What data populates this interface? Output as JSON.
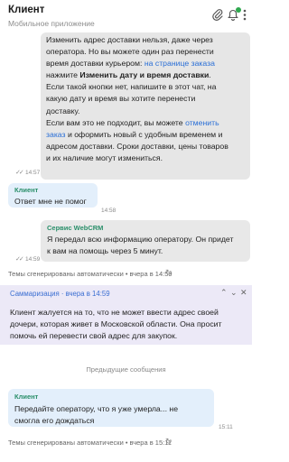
{
  "header": {
    "title": "Клиент",
    "subtitle": "Мобильное приложение"
  },
  "operator_message": {
    "line1": "Изменить адрес доставки нельзя, даже через",
    "line2": "оператора. Но вы можете один раз перенести",
    "line3a": "время доставки курьером: ",
    "line3_link": "на странице заказа",
    "line4a": "нажмите ",
    "line4_bold": "Изменить дату и время доставки",
    "line4b": ".",
    "line5": "Если такой кнопки нет, напишите в этот чат, на",
    "line6": "какую дату и время вы хотите перенести",
    "line7": "доставку.",
    "line8a": "Если вам это не подходит, вы можете ",
    "line8_link": "отменить",
    "line9_link": "заказ",
    "line9b": " и оформить новый с удобным временем и",
    "line10": "адресом доставки. Сроки доставки, цены товаров",
    "line11": "и их наличие могут измениться.",
    "time": "14:57"
  },
  "client_message_1": {
    "sender": "Клиент",
    "text": "Ответ мне не помог",
    "time": "14:58"
  },
  "bot_message": {
    "sender": "Сервис WebCRM",
    "line1": "Я передал всю информацию оператору. Он придет",
    "line2": "к вам на помощь через 5 минут.",
    "time": "14:59"
  },
  "system_1": "Темы сгенерированы автоматически • вчера в 14:59",
  "summary": {
    "title": "Саммаризация · вчера в 14:59",
    "line1": "Клиент жалуется на то, что не может ввести адрес своей",
    "line2": "дочери, которая живет в Московской области. Она просит",
    "line3": "помочь ей перевести свой адрес для закупок."
  },
  "divider": "Предыдущие сообщения",
  "client_message_2": {
    "sender": "Клиент",
    "line1": "Передайте оператору, что я уже умерла... не",
    "line2": "смогла его дождаться",
    "time": "15:11"
  },
  "system_2": "Темы сгенерированы автоматически • вчера в 15:11",
  "colors": {
    "link": "#2a6fd6",
    "sender_green": "#2a8f6a",
    "summary_bg": "#ece9f7",
    "client_bubble": "#e3effb",
    "operator_bubble": "#e6e6e6",
    "badge": "#2fa84f"
  },
  "icons": [
    "attachment-icon",
    "bell-icon",
    "more-vertical-icon",
    "double-check-icon",
    "refresh-icon",
    "chevron-up-icon",
    "chevron-down-icon",
    "close-icon"
  ]
}
